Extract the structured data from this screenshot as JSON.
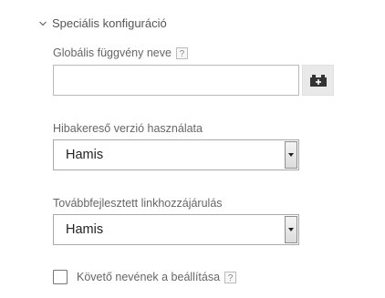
{
  "section": {
    "title": "Speciális konfiguráció",
    "icon": "chevron-down-icon"
  },
  "fields": {
    "global_function": {
      "label": "Globális függvény neve",
      "help": "?",
      "value": "",
      "button_icon": "variable-picker-icon"
    },
    "debug_version": {
      "label": "Hibakereső verzió használata",
      "help": "",
      "value": "Hamis"
    },
    "enhanced_link": {
      "label": "Továbbfejlesztett linkhozzájárulás",
      "help": "",
      "value": "Hamis"
    },
    "tracker_name": {
      "label": "Követő nevének a beállítása",
      "help": "?",
      "checked": false
    }
  }
}
